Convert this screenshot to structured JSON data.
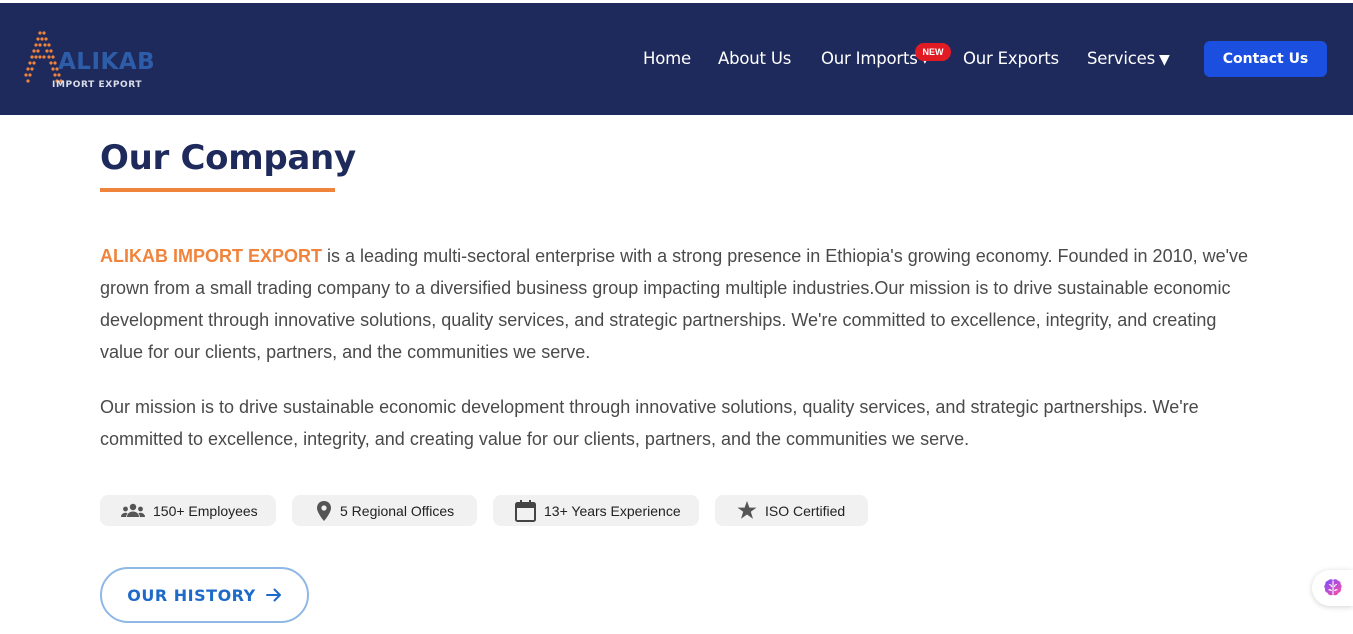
{
  "brand": {
    "logo_word": "ALIKAB",
    "logo_sub": "IMPORT EXPORT",
    "colors": {
      "navy": "#1f2a5c",
      "orange": "#f0843c",
      "blue": "#1a4fe0",
      "badge": "#e01b24"
    }
  },
  "nav": {
    "items": [
      {
        "label": "Home"
      },
      {
        "label": "About Us"
      },
      {
        "label": "Our Imports",
        "caret": "▾"
      },
      {
        "label": "Our Exports"
      },
      {
        "label": "Services",
        "caret": "▼"
      }
    ],
    "new_badge": "NEW",
    "contact_label": "Contact Us"
  },
  "main": {
    "title": "Our Company",
    "brand_name": "ALIKAB IMPORT EXPORT",
    "para1_rest": " is a leading multi-sectoral enterprise with a strong presence in Ethiopia's growing economy. Founded in 2010, we've grown from a small trading company to a diversified business group impacting multiple industries.Our mission is to drive sustainable economic development through innovative solutions, quality services, and strategic partnerships. We're committed to excellence, integrity, and creating value for our clients, partners, and the communities we serve.",
    "para2": "Our mission is to drive sustainable economic development through innovative solutions, quality services, and strategic partnerships. We're committed to excellence, integrity, and creating value for our clients, partners, and the communities we serve.",
    "stats": [
      {
        "icon": "people-icon",
        "label": "150+ Employees"
      },
      {
        "icon": "location-pin-icon",
        "label": "5 Regional Offices"
      },
      {
        "icon": "calendar-icon",
        "label": "13+ Years Experience"
      },
      {
        "icon": "star-icon",
        "label": "ISO Certified"
      }
    ],
    "history_label": "OUR HISTORY"
  }
}
